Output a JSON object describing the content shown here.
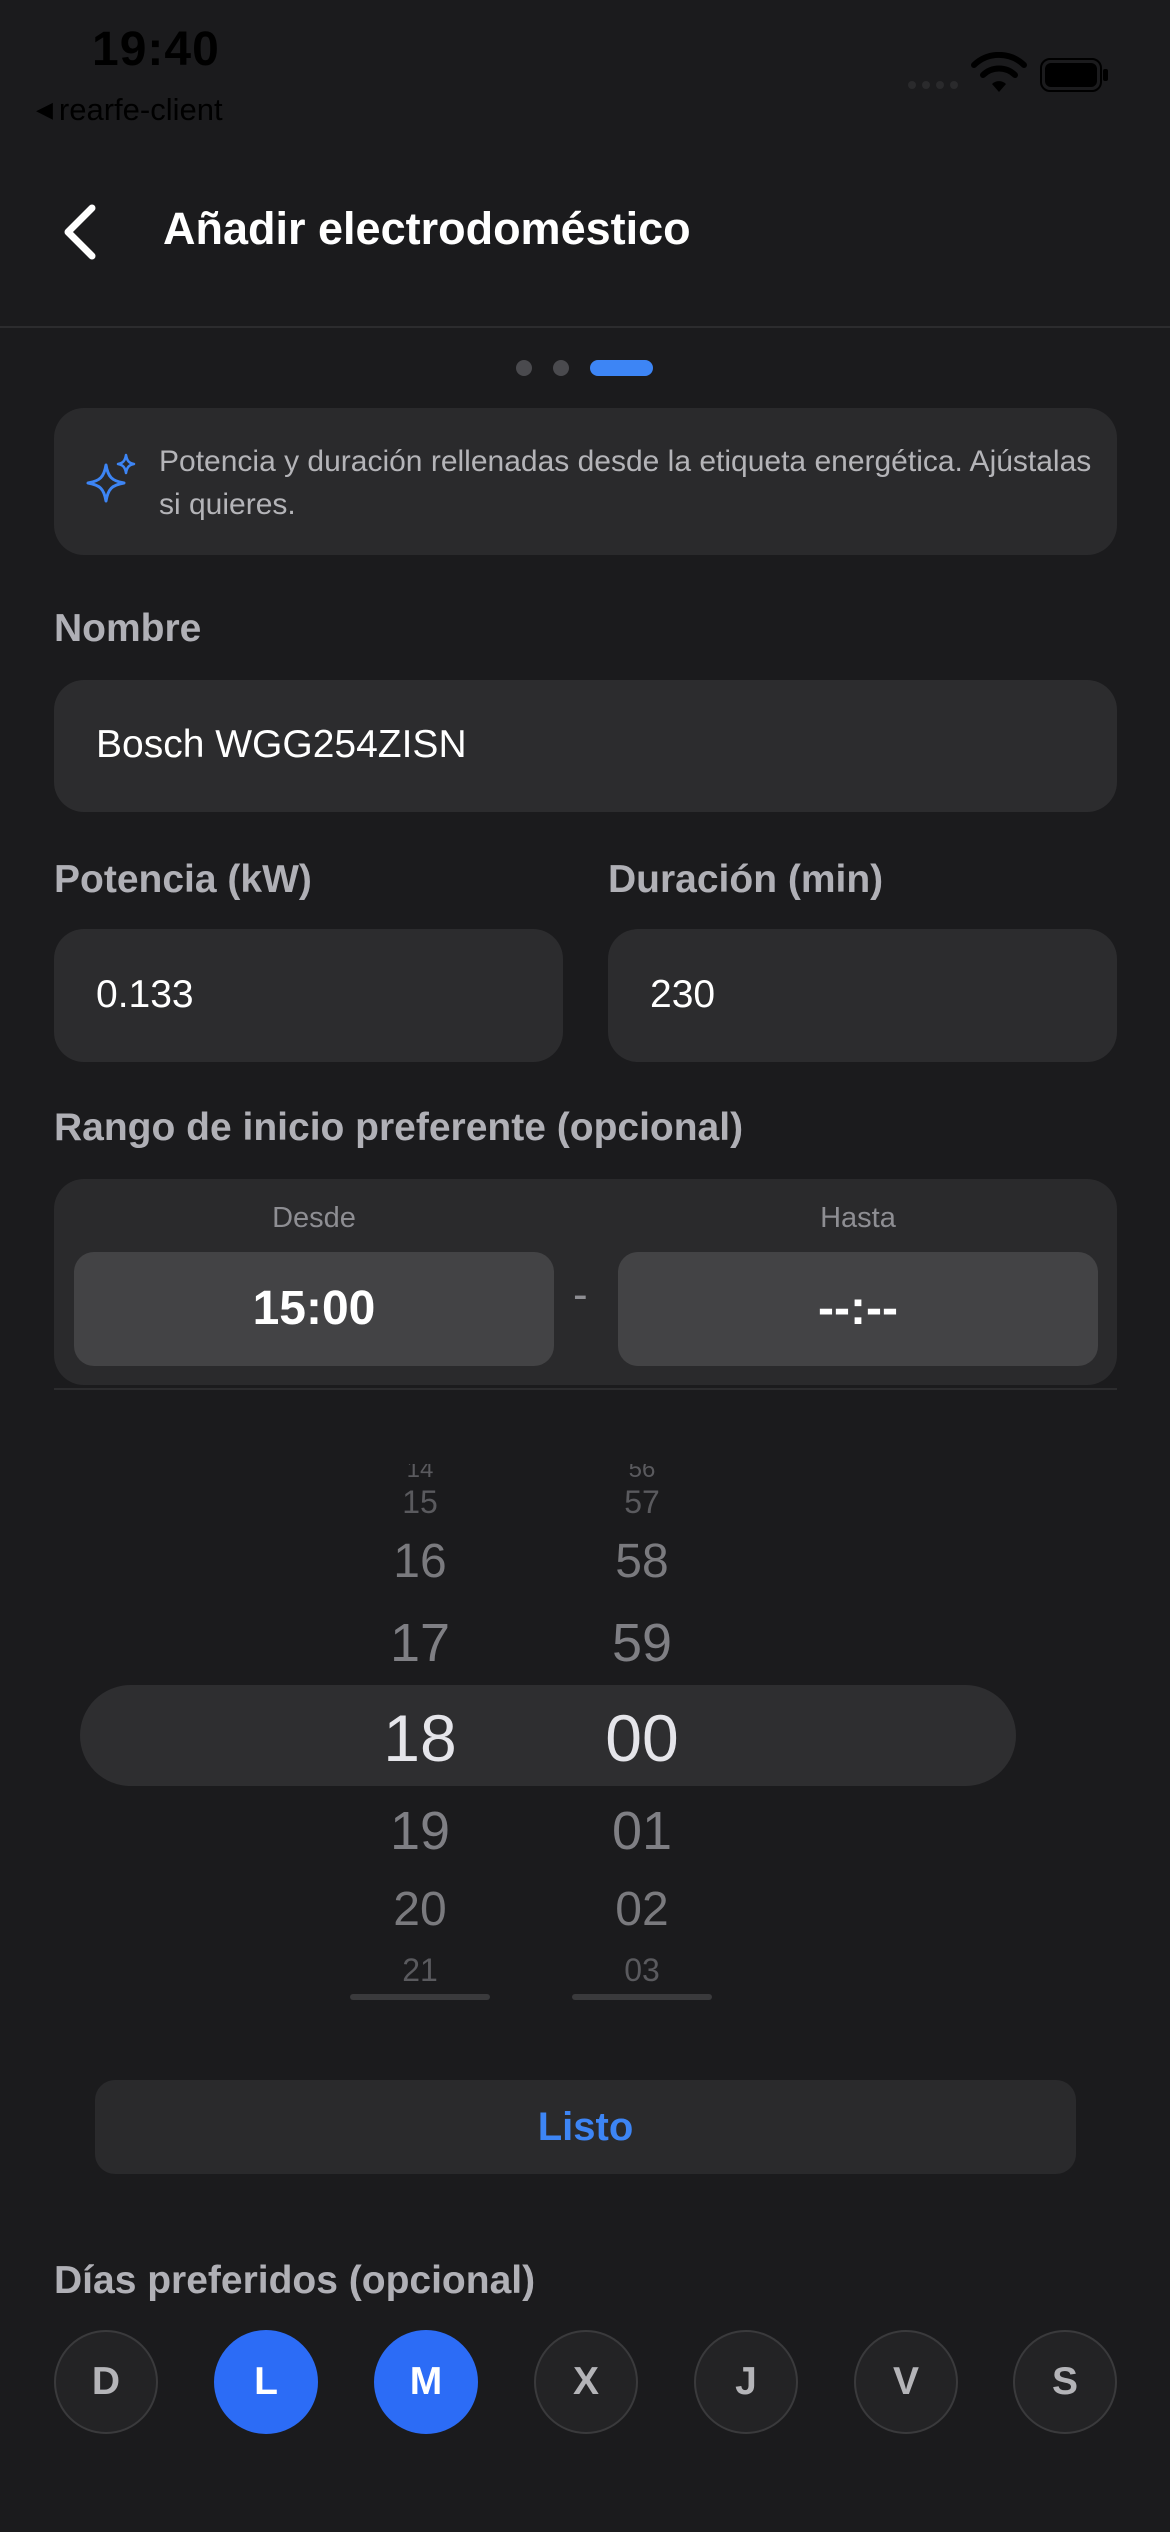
{
  "status_bar": {
    "time": "19:40",
    "back_app": "rearfe-client"
  },
  "header": {
    "title": "Añadir electrodoméstico"
  },
  "stepper": {
    "total_steps": 3,
    "current_step": 3
  },
  "banner": {
    "icon": "sparkles-icon",
    "text": "Potencia y duración rellenadas desde la etiqueta energética. Ajústalas si quieres."
  },
  "form": {
    "name_label": "Nombre",
    "name_value": "Bosch WGG254ZISN",
    "power_label": "Potencia (kW)",
    "power_value": "0.133",
    "duration_label": "Duración (min)",
    "duration_value": "230",
    "range_label": "Rango de inicio preferente (opcional)",
    "from_label": "Desde",
    "from_value": "15:00",
    "separator": "-",
    "to_label": "Hasta",
    "to_value": "--:--"
  },
  "picker": {
    "hours": [
      "15",
      "16",
      "17",
      "18",
      "19",
      "20",
      "21"
    ],
    "minutes": [
      "57",
      "58",
      "59",
      "00",
      "01",
      "02",
      "03"
    ],
    "selected_hour": "18",
    "selected_minute": "00"
  },
  "done_label": "Listo",
  "days": {
    "label": "Días preferidos (opcional)",
    "items": [
      {
        "letter": "D",
        "selected": false
      },
      {
        "letter": "L",
        "selected": true
      },
      {
        "letter": "M",
        "selected": true
      },
      {
        "letter": "X",
        "selected": false
      },
      {
        "letter": "J",
        "selected": false
      },
      {
        "letter": "V",
        "selected": false
      },
      {
        "letter": "S",
        "selected": false
      }
    ]
  },
  "colors": {
    "accent": "#3d85f5",
    "selected_day": "#2c6cf6",
    "background": "#1b1b1d"
  }
}
